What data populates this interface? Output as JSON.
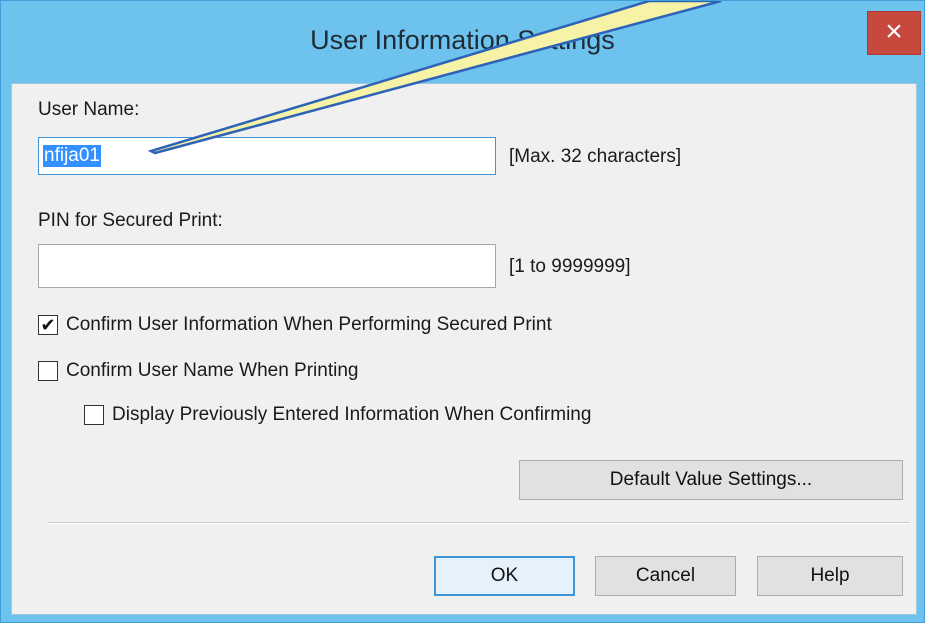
{
  "window": {
    "title": "User Information Settings",
    "close_symbol": "×"
  },
  "user_name": {
    "label": "User Name:",
    "value": "nfija01",
    "hint": "[Max. 32 characters]"
  },
  "pin": {
    "label": "PIN for Secured Print:",
    "value": "",
    "hint": "[1 to 9999999]"
  },
  "checkboxes": [
    {
      "label": "Confirm User Information When Performing Secured Print",
      "checked": true,
      "mark": "✔"
    },
    {
      "label": "Confirm User Name When Printing",
      "checked": false,
      "mark": ""
    },
    {
      "label": "Display Previously Entered Information When Confirming",
      "checked": false,
      "mark": ""
    }
  ],
  "buttons": {
    "default_values": "Default Value Settings...",
    "ok": "OK",
    "cancel": "Cancel",
    "help": "Help"
  },
  "colors": {
    "title_bar": "#6ec3ee",
    "focus": "#3c95d6",
    "selection": "#3390ff",
    "close": "#c7483d",
    "callout": "#f7f3a6"
  }
}
